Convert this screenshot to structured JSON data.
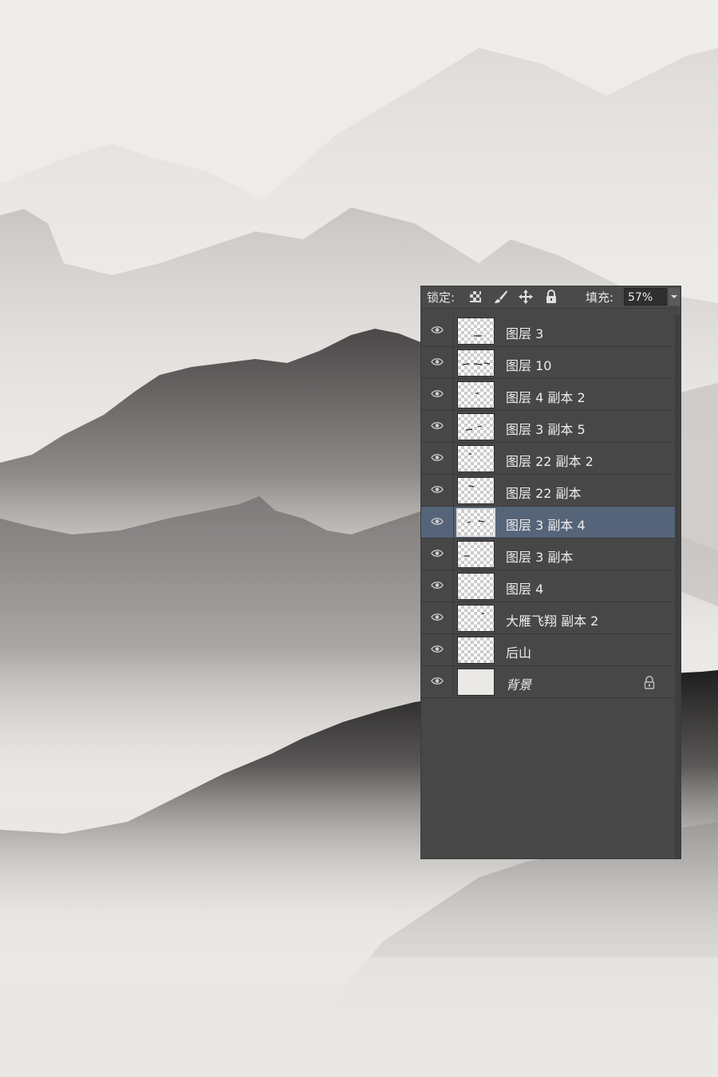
{
  "panel": {
    "lock_label": "锁定:",
    "fill_label": "填充:",
    "fill_value": "57%",
    "lock_icons": [
      "lock-transparent-pixels-icon",
      "lock-image-pixels-icon",
      "lock-position-icon",
      "lock-all-icon"
    ]
  },
  "layers": [
    {
      "name": "图层 3",
      "selected": false
    },
    {
      "name": "图层 10",
      "selected": false
    },
    {
      "name": "图层 4 副本 2",
      "selected": false
    },
    {
      "name": "图层 3 副本 5",
      "selected": false
    },
    {
      "name": "图层 22 副本 2",
      "selected": false
    },
    {
      "name": "图层 22 副本",
      "selected": false
    },
    {
      "name": "图层 3 副本 4",
      "selected": true
    },
    {
      "name": "图层 3 副本",
      "selected": false
    },
    {
      "name": "图层 4",
      "selected": false
    },
    {
      "name": "大雁飞翔 副本 2",
      "selected": false
    },
    {
      "name": "后山",
      "selected": false
    },
    {
      "name": "背景",
      "selected": false,
      "locked": true
    }
  ],
  "colors": {
    "panel_bg": "#474747",
    "selected_row": "#566479",
    "text": "#ececec"
  }
}
